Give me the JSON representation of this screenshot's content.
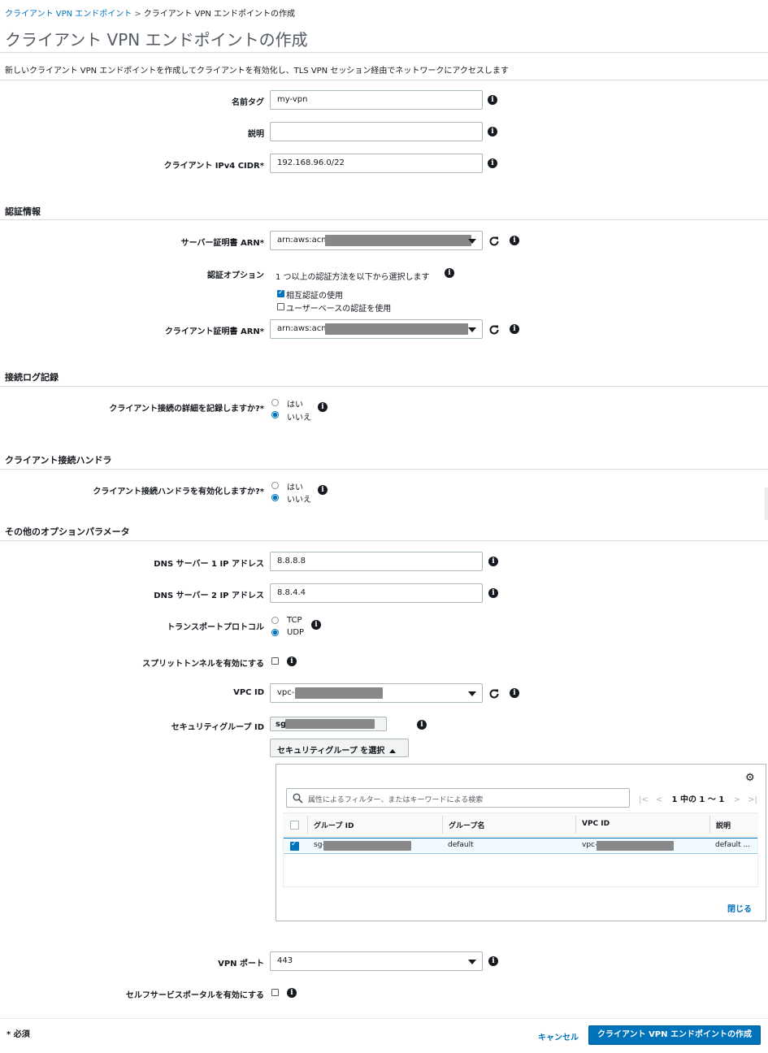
{
  "breadcrumb": {
    "parent": "クライアント VPN エンドポイント",
    "separator": ">",
    "current": "クライアント VPN エンドポイントの作成"
  },
  "page": {
    "title": "クライアント VPN エンドポイントの作成",
    "description": "新しいクライアント VPN エンドポイントを作成してクライアントを有効化し、TLS VPN セッション経由でネットワークにアクセスします"
  },
  "general": {
    "name_tag_label": "名前タグ",
    "name_tag_value": "my-vpn",
    "description_label": "説明",
    "description_value": "",
    "cidr_label": "クライアント IPv4 CIDR*",
    "cidr_value": "192.168.96.0/22"
  },
  "auth": {
    "section_title": "認証情報",
    "server_cert_label": "サーバー証明書 ARN*",
    "server_cert_value": "arn:aws:acm",
    "auth_option_label": "認証オプション",
    "auth_option_hint": "1 つ以上の認証方法を以下から選択します",
    "mutual_auth_label": "相互認証の使用",
    "mutual_auth_checked": true,
    "user_based_label": "ユーザーベースの認証を使用",
    "user_based_checked": false,
    "client_cert_label": "クライアント証明書 ARN*",
    "client_cert_value": "arn:aws:acm"
  },
  "logging": {
    "section_title": "接続ログ記録",
    "question": "クライアント接続の詳細を記録しますか?*",
    "yes": "はい",
    "no": "いいえ",
    "selected": "no"
  },
  "handler": {
    "section_title": "クライアント接続ハンドラ",
    "question": "クライアント接続ハンドラを有効化しますか?*",
    "yes": "はい",
    "no": "いいえ",
    "selected": "no"
  },
  "optional": {
    "section_title": "その他のオプションパラメータ",
    "dns1_label": "DNS サーバー 1 IP アドレス",
    "dns1_value": "8.8.8.8",
    "dns2_label": "DNS サーバー 2 IP アドレス",
    "dns2_value": "8.8.4.4",
    "transport_label": "トランスポートプロトコル",
    "tcp": "TCP",
    "udp": "UDP",
    "transport_selected": "UDP",
    "split_tunnel_label": "スプリットトンネルを有効にする",
    "split_tunnel_checked": false,
    "vpc_label": "VPC ID",
    "vpc_value": "vpc-",
    "sg_label": "セキュリティグループ ID",
    "sg_token": "sg",
    "sg_button": "セキュリティグループ を選択",
    "vpn_port_label": "VPN ポート",
    "vpn_port_value": "443",
    "self_service_label": "セルフサービスポータルを有効にする",
    "self_service_checked": false
  },
  "sg_panel": {
    "filter_placeholder": "属性によるフィルター、またはキーワードによる検索",
    "pager_text": "1 中の 1 ～ 1",
    "columns": [
      "グループ ID",
      "グループ名",
      "VPC ID",
      "説明"
    ],
    "rows": [
      {
        "group_id": "sg-",
        "group_name": "default",
        "vpc_id": "vpc-",
        "description": "default ...",
        "selected": true
      }
    ],
    "close_label": "閉じる"
  },
  "footer": {
    "required_note": "* 必須",
    "cancel_label": "キャンセル",
    "submit_label": "クライアント VPN エンドポイントの作成"
  },
  "colors": {
    "link": "#0073bb",
    "primary": "#0073bb",
    "text": "#16191f",
    "muted": "#545b64",
    "border": "#aab7b8",
    "redaction": "#888888"
  }
}
